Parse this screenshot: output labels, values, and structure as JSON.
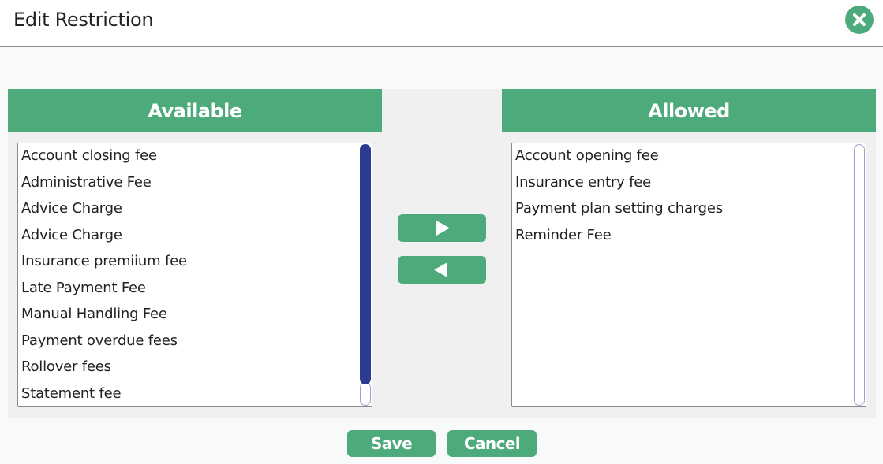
{
  "dialog": {
    "title": "Edit Restriction",
    "close_icon": "close-circle-icon"
  },
  "available": {
    "header": "Available",
    "items": [
      "Account closing fee",
      "Administrative Fee",
      "Advice Charge",
      "Advice Charge",
      "Insurance premiium fee",
      "Late Payment Fee",
      "Manual Handling Fee",
      "Payment overdue fees",
      "Rollover fees",
      "Statement fee"
    ]
  },
  "allowed": {
    "header": "Allowed",
    "items": [
      "Account opening fee",
      "Insurance entry fee",
      "Payment plan setting charges",
      "Reminder Fee"
    ]
  },
  "transfer": {
    "move_right_icon": "triangle-right-icon",
    "move_left_icon": "triangle-left-icon"
  },
  "footer": {
    "save_label": "Save",
    "cancel_label": "Cancel"
  },
  "colors": {
    "accent": "#4caa7b",
    "scrollbar_thumb": "#2b3c91"
  }
}
